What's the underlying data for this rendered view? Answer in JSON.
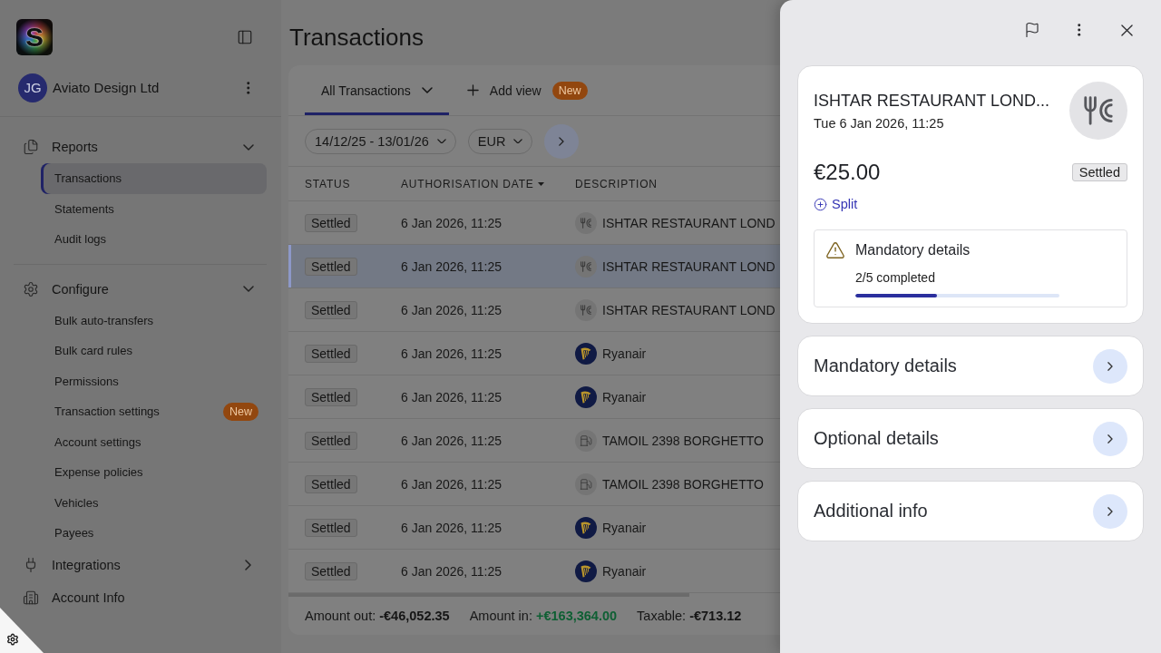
{
  "sidebar": {
    "logo": "S",
    "account": {
      "initials": "JG",
      "name": "Aviato Design Ltd"
    },
    "nav_groups": [
      {
        "sections": [
          {
            "label": "Reports",
            "kind": "reports",
            "expanded": true,
            "items": [
              {
                "label": "Transactions",
                "selected": true
              },
              {
                "label": "Statements",
                "selected": false
              },
              {
                "label": "Audit logs",
                "selected": false
              }
            ]
          }
        ]
      },
      {
        "sections": [
          {
            "label": "Configure",
            "kind": "configure",
            "expanded": true,
            "items": [
              {
                "label": "Bulk auto-transfers",
                "selected": false
              },
              {
                "label": "Bulk card rules",
                "selected": false
              },
              {
                "label": "Permissions",
                "selected": false
              },
              {
                "label": "Transaction settings",
                "selected": false,
                "badge": "New"
              },
              {
                "label": "Account settings",
                "selected": false
              },
              {
                "label": "Expense policies",
                "selected": false
              },
              {
                "label": "Vehicles",
                "selected": false
              },
              {
                "label": "Payees",
                "selected": false
              }
            ]
          },
          {
            "label": "Integrations",
            "kind": "integrations",
            "expanded": false
          },
          {
            "label": "Account Info",
            "kind": "account"
          }
        ]
      }
    ]
  },
  "page_title": "Transactions",
  "views": {
    "tabs": [
      {
        "label": "All Transactions",
        "selected": true
      }
    ],
    "add_view": {
      "label": "Add view",
      "badge": "New"
    }
  },
  "filters": {
    "date_range": "14/12/25 - 13/01/26",
    "currency": "EUR"
  },
  "table": {
    "columns": [
      {
        "label": "STATUS",
        "sorted": false
      },
      {
        "label": "AUTHORISATION DATE",
        "sorted": true
      },
      {
        "label": "DESCRIPTION",
        "sorted": false
      }
    ],
    "rows": [
      {
        "status": "Settled",
        "date": "6 Jan 2026, 11:25",
        "description": "ISHTAR RESTAURANT LOND",
        "kind": "restaurant",
        "selected": false
      },
      {
        "status": "Settled",
        "date": "6 Jan 2026, 11:25",
        "description": "ISHTAR RESTAURANT LOND",
        "kind": "restaurant",
        "selected": true
      },
      {
        "status": "Settled",
        "date": "6 Jan 2026, 11:25",
        "description": "ISHTAR RESTAURANT LOND",
        "kind": "restaurant",
        "selected": false
      },
      {
        "status": "Settled",
        "date": "6 Jan 2026, 11:25",
        "description": "Ryanair",
        "kind": "airline",
        "selected": false
      },
      {
        "status": "Settled",
        "date": "6 Jan 2026, 11:25",
        "description": "Ryanair",
        "kind": "airline",
        "selected": false
      },
      {
        "status": "Settled",
        "date": "6 Jan 2026, 11:25",
        "description": "TAMOIL 2398 BORGHETTO",
        "kind": "fuel",
        "selected": false
      },
      {
        "status": "Settled",
        "date": "6 Jan 2026, 11:25",
        "description": "TAMOIL 2398 BORGHETTO",
        "kind": "fuel",
        "selected": false
      },
      {
        "status": "Settled",
        "date": "6 Jan 2026, 11:25",
        "description": "Ryanair",
        "kind": "airline",
        "selected": false
      },
      {
        "status": "Settled",
        "date": "6 Jan 2026, 11:25",
        "description": "Ryanair",
        "kind": "airline",
        "selected": false
      }
    ]
  },
  "totals": [
    {
      "label": "Amount out:",
      "value": "-€46,052.35",
      "kind": "neutral"
    },
    {
      "label": "Amount in:",
      "value": "+€163,364.00",
      "kind": "positive"
    },
    {
      "label": "Taxable:",
      "value": "-€713.12",
      "kind": "neutral"
    }
  ],
  "detail_panel": {
    "title": "ISHTAR RESTAURANT LOND...",
    "datetime": "Tue 6 Jan 2026, 11:25",
    "kind": "restaurant",
    "amount": "€25.00",
    "status": "Settled",
    "split_label": "Split",
    "checklist": {
      "title": "Mandatory details",
      "progress_text": "2/5 completed",
      "level": 0.4
    },
    "sections": [
      {
        "label": "Mandatory details"
      },
      {
        "label": "Optional details"
      },
      {
        "label": "Additional info"
      }
    ]
  }
}
